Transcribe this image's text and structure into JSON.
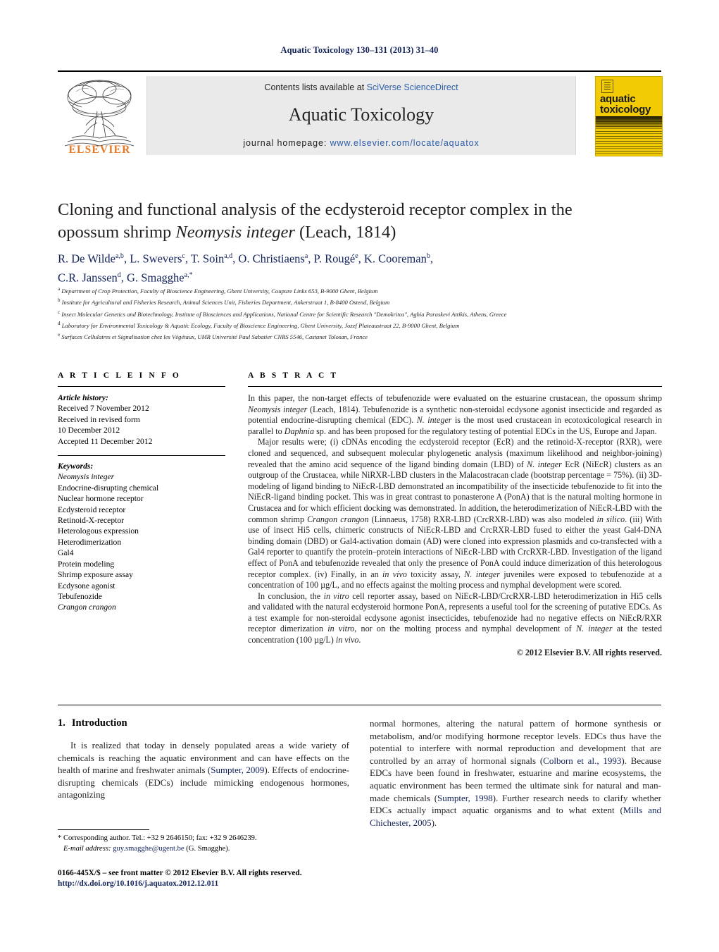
{
  "running_head": "Aquatic Toxicology 130–131 (2013) 31–40",
  "masthead": {
    "contents_line_prefix": "Contents lists available at ",
    "sciencedirect": "SciVerse ScienceDirect",
    "journal_title": "Aquatic Toxicology",
    "homepage_label": "journal homepage: ",
    "homepage_url": "www.elsevier.com/locate/aquatox",
    "publisher": "ELSEVIER",
    "cover_title_line1": "aquatic",
    "cover_title_line2": "toxicology",
    "accent_blue": "#2a5caa",
    "publisher_orange": "#e87722",
    "cover_yellow": "#f2cb05"
  },
  "article": {
    "title_line1": "Cloning and functional analysis of the ecdysteroid receptor complex in the",
    "title_line2_pre": "opossum shrimp ",
    "title_species": "Neomysis integer",
    "title_line2_post": " (Leach, 1814)",
    "authors_line1": "R. De Wilde",
    "authors_html": "R. De Wilde a,b, L. Swevers c, T. Soin a,d, O. Christiaens a, P. Rougé e, K. Cooreman b, C.R. Janssen d, G. Smagghe a,*",
    "affiliations": [
      "a Department of Crop Protection, Faculty of Bioscience Engineering, Ghent University, Coupure Links 653, B-9000 Ghent, Belgium",
      "b Institute for Agricultural and Fisheries Research, Animal Sciences Unit, Fisheries Department, Ankerstraat 1, B-8400 Ostend, Belgium",
      "c Insect Molecular Genetics and Biotechnology, Institute of Biosciences and Applications, National Centre for Scientific Research \"Demokritos\", Aghia Paraskevi Attikis, Athens, Greece",
      "d Laboratory for Environmental Toxicology & Aquatic Ecology, Faculty of Bioscience Engineering, Ghent University, Jozef Plateaustraat 22, B-9000 Ghent, Belgium",
      "e Surfaces Cellulaires et Signalisation chez les Végétaux, UMR Université Paul Sabatier CNRS 5546, Castanet Tolosan, France"
    ]
  },
  "article_info": {
    "heading": "A R T I C L E   I N F O",
    "history_label": "Article history:",
    "history": [
      "Received 7 November 2012",
      "Received in revised form",
      "10 December 2012",
      "Accepted 11 December 2012"
    ],
    "keywords_label": "Keywords:",
    "keywords": [
      "Neomysis integer",
      "Endocrine-disrupting chemical",
      "Nuclear hormone receptor",
      "Ecdysteroid receptor",
      "Retinoid-X-receptor",
      "Heterologous expression",
      "Heterodimerization",
      "Gal4",
      "Protein modeling",
      "Shrimp exposure assay",
      "Ecdysone agonist",
      "Tebufenozide",
      "Crangon crangon"
    ]
  },
  "abstract": {
    "heading": "A B S T R A C T",
    "paragraphs": [
      "In this paper, the non-target effects of tebufenozide were evaluated on the estuarine crustacean, the opossum shrimp Neomysis integer (Leach, 1814). Tebufenozide is a synthetic non-steroidal ecdysone agonist insecticide and regarded as potential endocrine-disrupting chemical (EDC). N. integer is the most used crustacean in ecotoxicological research in parallel to Daphnia sp. and has been proposed for the regulatory testing of potential EDCs in the US, Europe and Japan.",
      "Major results were; (i) cDNAs encoding the ecdysteroid receptor (EcR) and the retinoid-X-receptor (RXR), were cloned and sequenced, and subsequent molecular phylogenetic analysis (maximum likelihood and neighbor-joining) revealed that the amino acid sequence of the ligand binding domain (LBD) of N. integer EcR (NiEcR) clusters as an outgroup of the Crustacea, while NiRXR-LBD clusters in the Malacostracan clade (bootstrap percentage = 75%). (ii) 3D-modeling of ligand binding to NiEcR-LBD demonstrated an incompatibility of the insecticide tebufenozide to fit into the NiEcR-ligand binding pocket. This was in great contrast to ponasterone A (PonA) that is the natural molting hormone in Crustacea and for which efficient docking was demonstrated. In addition, the heterodimerization of NiEcR-LBD with the common shrimp Crangon crangon (Linnaeus, 1758) RXR-LBD (CrcRXR-LBD) was also modeled in silico. (iii) With use of insect Hi5 cells, chimeric constructs of NiEcR-LBD and CrcRXR-LBD fused to either the yeast Gal4-DNA binding domain (DBD) or Gal4-activation domain (AD) were cloned into expression plasmids and co-transfected with a Gal4 reporter to quantify the protein–protein interactions of NiEcR-LBD with CrcRXR-LBD. Investigation of the ligand effect of PonA and tebufenozide revealed that only the presence of PonA could induce dimerization of this heterologous receptor complex. (iv) Finally, in an in vivo toxicity assay, N. integer juveniles were exposed to tebufenozide at a concentration of 100 µg/L, and no effects against the molting process and nymphal development were scored.",
      "In conclusion, the in vitro cell reporter assay, based on NiEcR-LBD/CrcRXR-LBD heterodimerization in Hi5 cells and validated with the natural ecdysteroid hormone PonA, represents a useful tool for the screening of putative EDCs. As a test example for non-steroidal ecdysone agonist insecticides, tebufenozide had no negative effects on NiEcR/RXR receptor dimerization in vitro, nor on the molting process and nymphal development of N. integer at the tested concentration (100 µg/L) in vivo."
    ],
    "copyright": "© 2012 Elsevier B.V. All rights reserved."
  },
  "introduction": {
    "number": "1.",
    "heading": "Introduction",
    "left_paragraph": "It is realized that today in densely populated areas a wide variety of chemicals is reaching the aquatic environment and can have effects on the health of marine and freshwater animals (Sumpter, 2009). Effects of endocrine-disrupting chemicals (EDCs) include mimicking endogenous hormones, antagonizing",
    "right_paragraph": "normal hormones, altering the natural pattern of hormone synthesis or metabolism, and/or modifying hormone receptor levels. EDCs thus have the potential to interfere with normal reproduction and development that are controlled by an array of hormonal signals (Colborn et al., 1993). Because EDCs have been found in freshwater, estuarine and marine ecosystems, the aquatic environment has been termed the ultimate sink for natural and man-made chemicals (Sumpter, 1998). Further research needs to clarify whether EDCs actually impact aquatic organisms and to what extent (Mills and Chichester, 2005).",
    "citations": [
      "Sumpter, 2009",
      "Colborn et al., 1993",
      "Sumpter, 1998",
      "Mills and Chichester, 2005"
    ]
  },
  "footnotes": {
    "corresponding": "* Corresponding author. Tel.: +32 9 2646150; fax: +32 9 2646239.",
    "email_label": "E-mail address:",
    "email": "guy.smagghe@ugent.be",
    "email_suffix": "(G. Smagghe).",
    "issn_line": "0166-445X/$ – see front matter © 2012 Elsevier B.V. All rights reserved.",
    "doi": "http://dx.doi.org/10.1016/j.aquatox.2012.12.011"
  }
}
